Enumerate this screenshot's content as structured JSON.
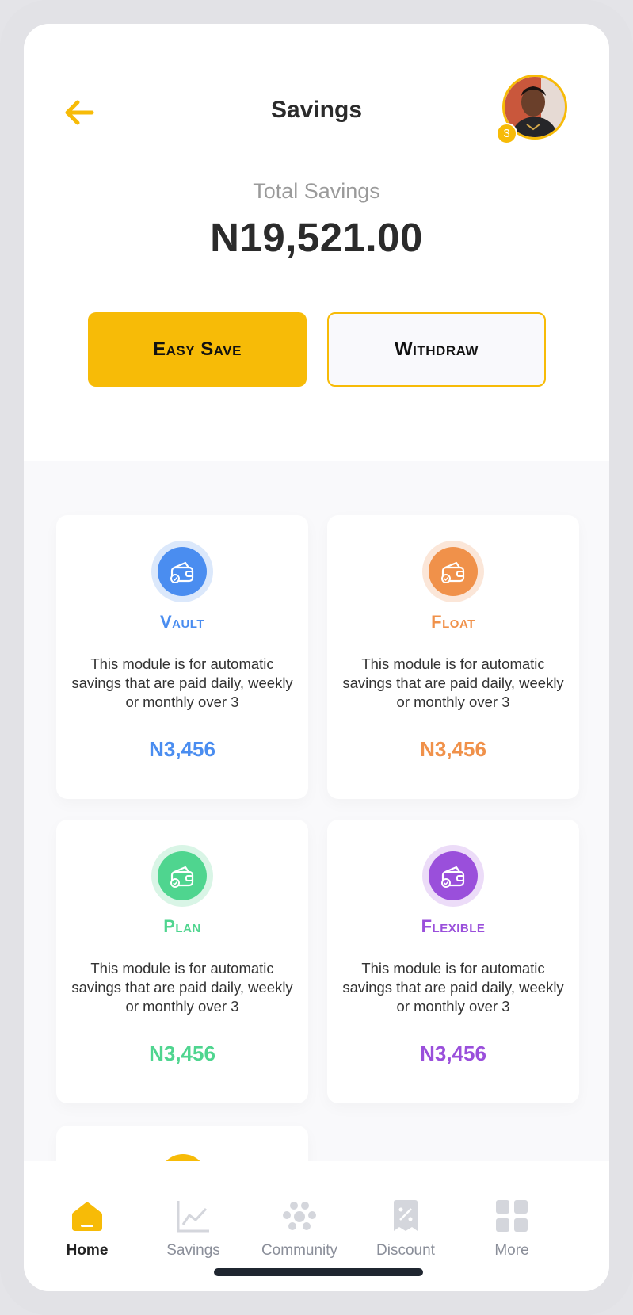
{
  "header": {
    "title": "Savings",
    "notification_count": "3"
  },
  "summary": {
    "label": "Total Savings",
    "amount": "N19,521.00"
  },
  "actions": {
    "easy_save": "Easy Save",
    "withdraw": "Withdraw"
  },
  "cards": [
    {
      "title": "Vault",
      "description": "This module is for automatic savings that are paid daily, weekly or monthly over 3",
      "amount": "N3,456",
      "color": "#4a8df0"
    },
    {
      "title": "Float",
      "description": "This module is for automatic savings that are paid daily, weekly or monthly over 3",
      "amount": "N3,456",
      "color": "#f0914a"
    },
    {
      "title": "Plan",
      "description": "This module is for automatic savings that are paid daily, weekly or monthly over 3",
      "amount": "N3,456",
      "color": "#4fd58f"
    },
    {
      "title": "Flexible",
      "description": "This module is for automatic savings that are paid daily, weekly or monthly over 3",
      "amount": "N3,456",
      "color": "#9a4fdb"
    }
  ],
  "tabs": [
    {
      "label": "Home",
      "icon": "home-icon"
    },
    {
      "label": "Savings",
      "icon": "chart-icon"
    },
    {
      "label": "Community",
      "icon": "community-icon"
    },
    {
      "label": "Discount",
      "icon": "discount-icon"
    },
    {
      "label": "More",
      "icon": "grid-icon"
    }
  ],
  "colors": {
    "accent": "#f7bb07",
    "text_dark": "#2b2b2b",
    "tab_inactive": "#8a8e99"
  }
}
